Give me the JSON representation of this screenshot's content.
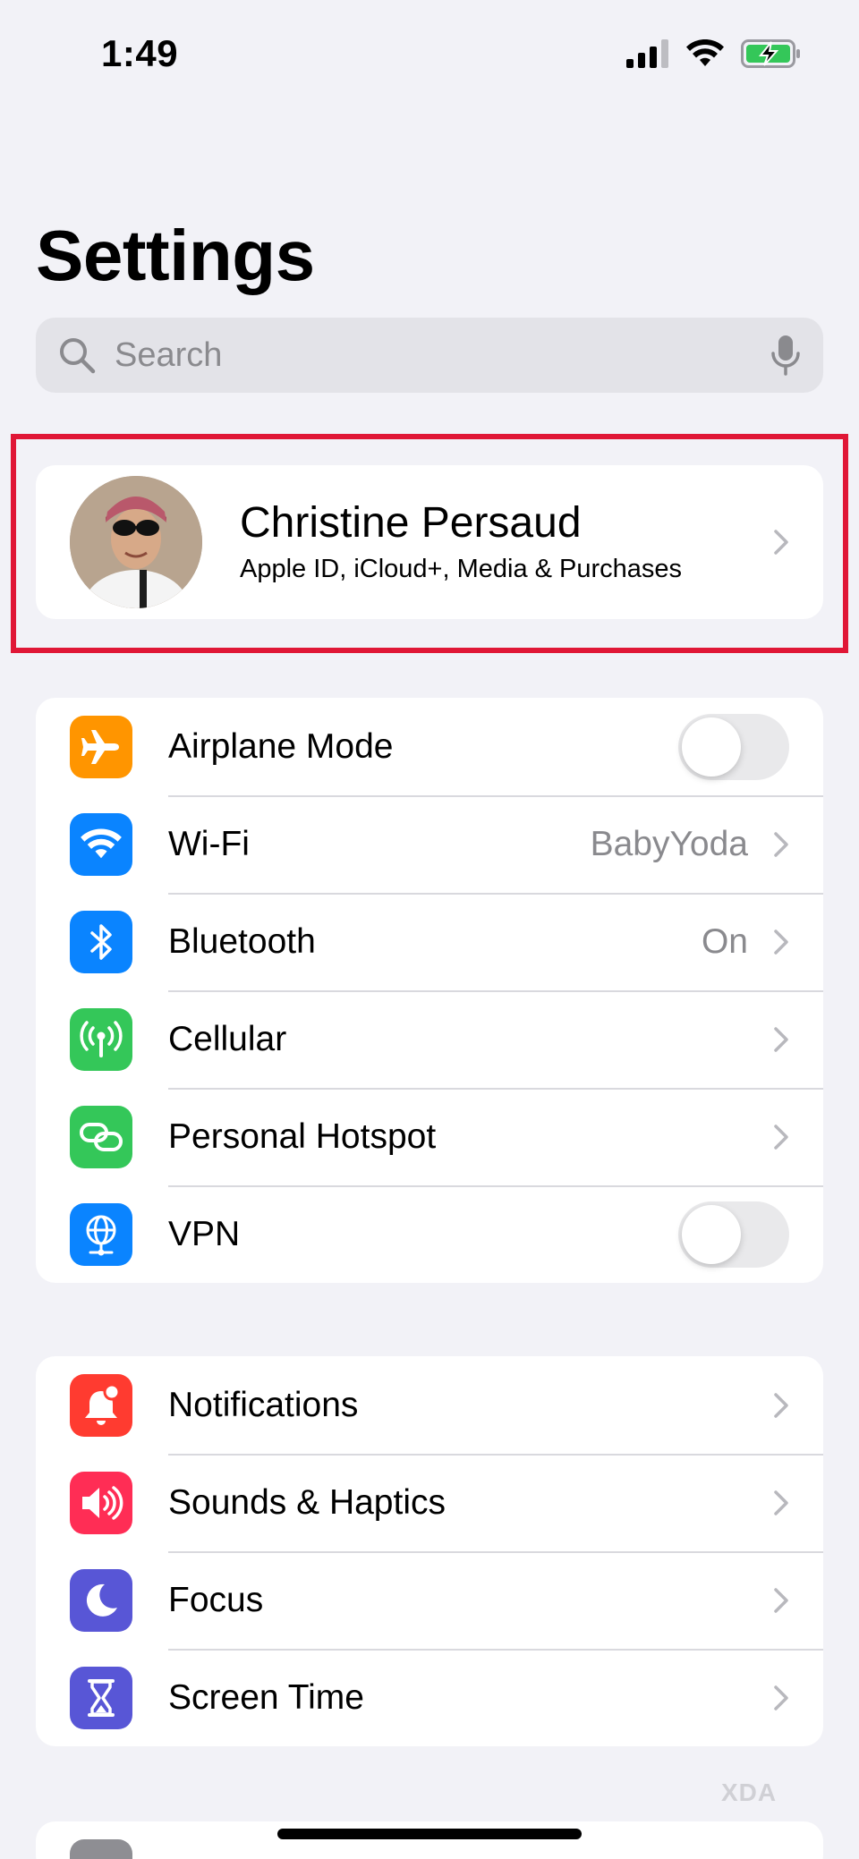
{
  "status_bar": {
    "time": "1:49",
    "icons": [
      "cellular-signal-icon",
      "wifi-icon",
      "battery-charging-icon"
    ]
  },
  "title": "Settings",
  "search": {
    "placeholder": "Search",
    "icons": [
      "search-icon",
      "microphone-icon"
    ]
  },
  "profile": {
    "name": "Christine Persaud",
    "subtitle": "Apple ID, iCloud+, Media & Purchases"
  },
  "connectivity": [
    {
      "label": "Airplane Mode",
      "icon": "airplane-icon",
      "color": "#ff9500",
      "control": "toggle",
      "on": false
    },
    {
      "label": "Wi-Fi",
      "icon": "wifi-icon",
      "color": "#0a84ff",
      "value": "BabyYoda",
      "control": "chevron"
    },
    {
      "label": "Bluetooth",
      "icon": "bluetooth-icon",
      "color": "#0a84ff",
      "value": "On",
      "control": "chevron"
    },
    {
      "label": "Cellular",
      "icon": "antenna-icon",
      "color": "#34c759",
      "control": "chevron"
    },
    {
      "label": "Personal Hotspot",
      "icon": "link-icon",
      "color": "#34c759",
      "control": "chevron"
    },
    {
      "label": "VPN",
      "icon": "globe-icon",
      "color": "#0a84ff",
      "control": "toggle",
      "on": false
    }
  ],
  "notifications": [
    {
      "label": "Notifications",
      "icon": "bell-icon",
      "color": "#ff3b30",
      "control": "chevron"
    },
    {
      "label": "Sounds & Haptics",
      "icon": "speaker-icon",
      "color": "#ff2d55",
      "control": "chevron"
    },
    {
      "label": "Focus",
      "icon": "moon-icon",
      "color": "#5856d6",
      "control": "chevron"
    },
    {
      "label": "Screen Time",
      "icon": "hourglass-icon",
      "color": "#5856d6",
      "control": "chevron"
    }
  ],
  "watermark": "XDA"
}
